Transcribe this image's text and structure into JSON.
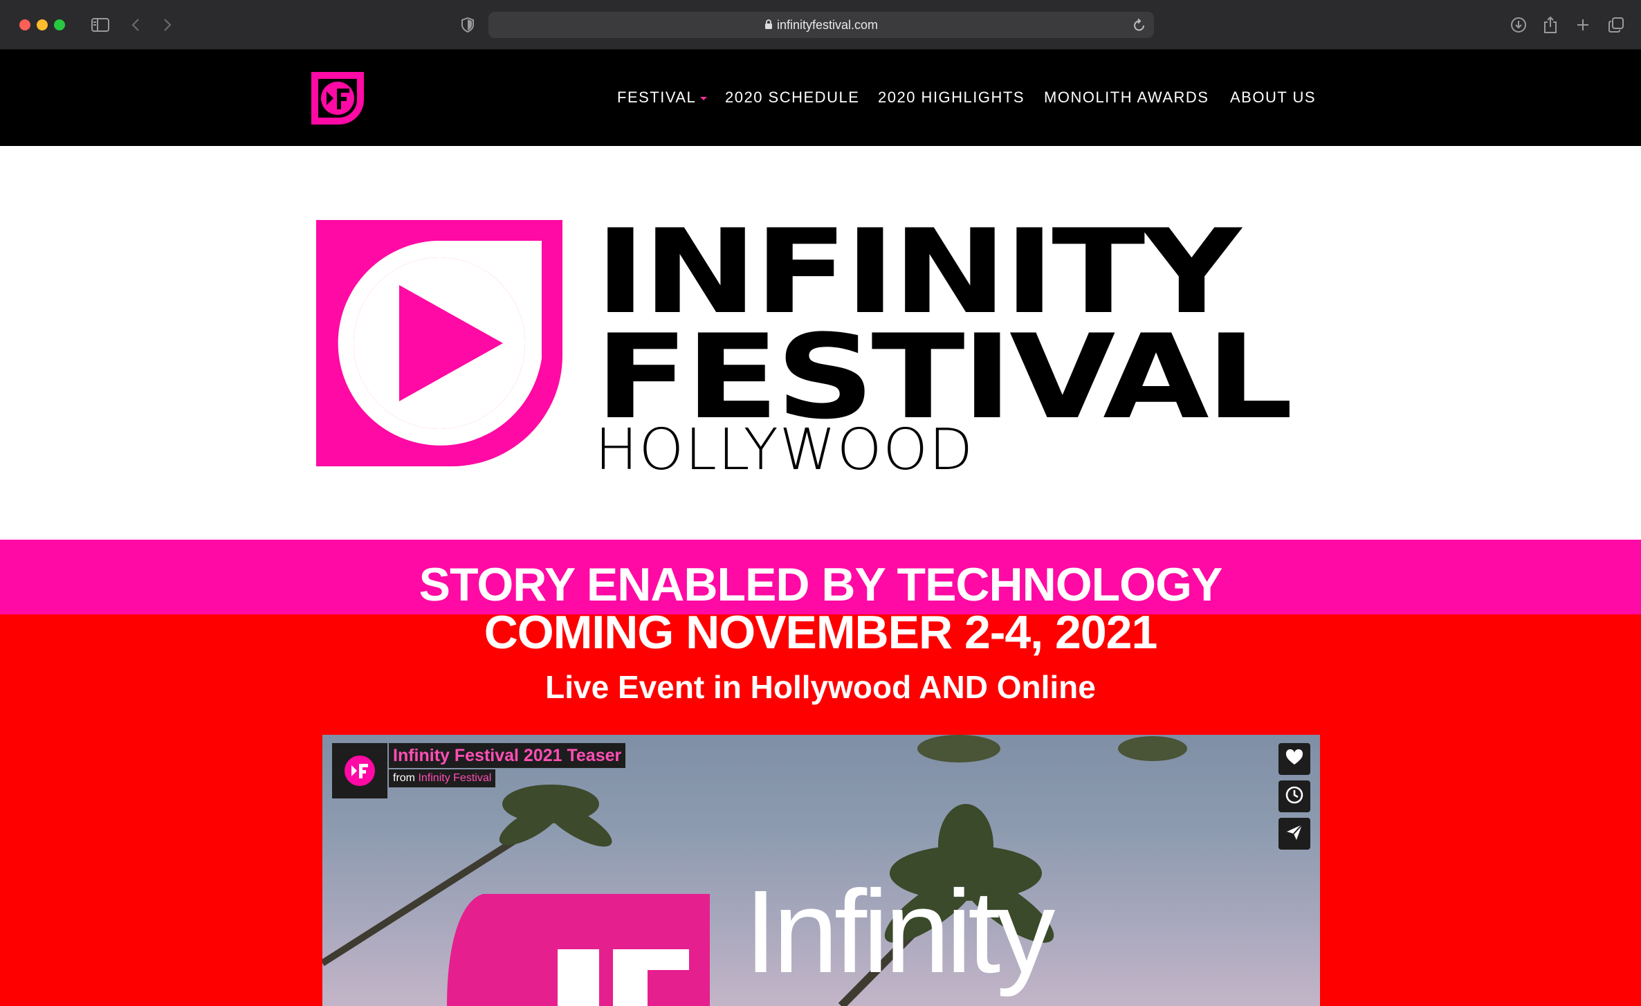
{
  "browser": {
    "url": "infinityfestival.com"
  },
  "nav": {
    "items": [
      {
        "label": "FESTIVAL",
        "has_dropdown": true
      },
      {
        "label": "2020 SCHEDULE"
      },
      {
        "label": "2020 HIGHLIGHTS"
      },
      {
        "label": "MONOLITH AWARDS"
      },
      {
        "label": "ABOUT US"
      }
    ]
  },
  "hero": {
    "line1": "INFINITY",
    "line2": "FESTIVAL",
    "line3": "HOLLYWOOD"
  },
  "banner": {
    "tagline": "STORY ENABLED BY TECHNOLOGY",
    "dates": "COMING NOVEMBER 2-4, 2021",
    "subtitle": "Live Event in Hollywood AND Online"
  },
  "video": {
    "title": "Infinity Festival 2021 Teaser",
    "from_prefix": "from",
    "from_channel": "Infinity Festival",
    "overlay_word": "Infinity",
    "actions": [
      "heart-icon",
      "clock-icon",
      "send-icon"
    ]
  },
  "colors": {
    "brand_pink": "#ff0aa4",
    "banner_red": "#ff0000",
    "nav_bg": "#000000"
  }
}
